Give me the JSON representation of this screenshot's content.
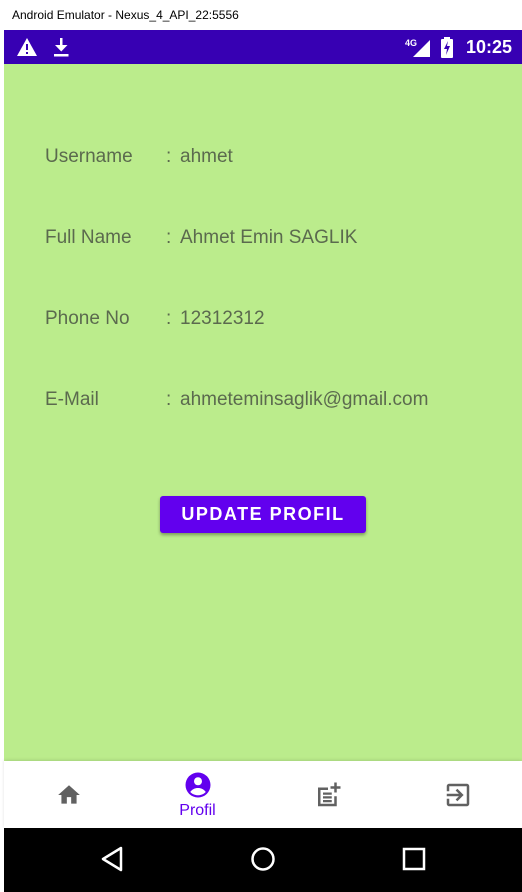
{
  "window": {
    "title": "Android Emulator - Nexus_4_API_22:5556"
  },
  "status_bar": {
    "time": "10:25",
    "network": "4G",
    "icons": [
      "warning-icon",
      "download-icon",
      "signal-4g-icon",
      "battery-charging-icon"
    ]
  },
  "profile": {
    "fields": [
      {
        "label": "Username",
        "separator": ":",
        "value": "ahmet"
      },
      {
        "label": "Full Name",
        "separator": ":",
        "value": "Ahmet Emin SAGLIK"
      },
      {
        "label": "Phone No",
        "separator": ":",
        "value": "12312312"
      },
      {
        "label": "E-Mail",
        "separator": ":",
        "value": "ahmeteminsaglik@gmail.com"
      }
    ],
    "update_button": "UPDATE PROFIL"
  },
  "bottom_nav": {
    "items": [
      {
        "icon": "home-icon",
        "label": ""
      },
      {
        "icon": "account-circle-icon",
        "label": "Profil",
        "active": true
      },
      {
        "icon": "post-add-icon",
        "label": ""
      },
      {
        "icon": "logout-icon",
        "label": ""
      }
    ]
  },
  "system_nav": [
    "back-icon",
    "home-circle-icon",
    "recents-icon"
  ],
  "colors": {
    "status_bar": "#3700b3",
    "content_background": "#bbec8c",
    "primary": "#6200ee",
    "text": "#5b6a4e",
    "nav_icon": "#616161"
  }
}
